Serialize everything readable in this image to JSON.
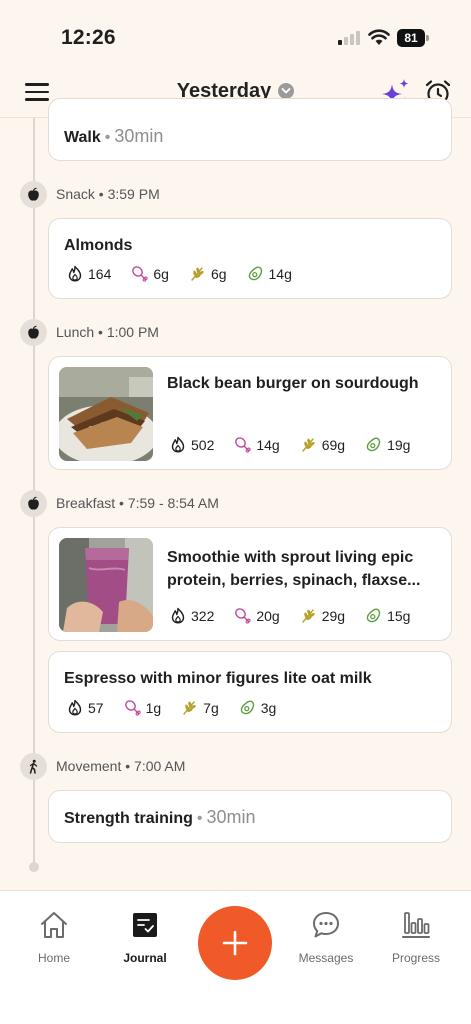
{
  "status_bar": {
    "time": "12:26",
    "battery": "81"
  },
  "header": {
    "title": "Yesterday"
  },
  "entries": {
    "walk": {
      "title": "Walk",
      "duration": "30min"
    },
    "snack": {
      "label": "Snack • 3:59 PM",
      "items": [
        {
          "title": "Almonds",
          "calories": "164",
          "protein": "6g",
          "carbs": "6g",
          "fat": "14g"
        }
      ]
    },
    "lunch": {
      "label": "Lunch • 1:00 PM",
      "items": [
        {
          "title": "Black bean burger on sourdough",
          "calories": "502",
          "protein": "14g",
          "carbs": "69g",
          "fat": "19g"
        }
      ]
    },
    "breakfast": {
      "label": "Breakfast • 7:59 - 8:54 AM",
      "items": [
        {
          "title_line1": "Smoothie with sprout living epic",
          "title_line2": "protein, berries, spinach, flaxse...",
          "calories": "322",
          "protein": "20g",
          "carbs": "29g",
          "fat": "15g"
        },
        {
          "title": "Espresso with minor figures lite oat milk",
          "calories": "57",
          "protein": "1g",
          "carbs": "7g",
          "fat": "3g"
        }
      ]
    },
    "movement": {
      "label": "Movement • 7:00 AM",
      "items": [
        {
          "title": "Strength training",
          "duration": "30min"
        }
      ]
    }
  },
  "nav": {
    "home": "Home",
    "journal": "Journal",
    "messages": "Messages",
    "progress": "Progress"
  },
  "icons": {
    "menu": "hamburger-icon",
    "title_dropdown": "chevron-down-icon",
    "ai": "sparkles-icon",
    "alarm": "alarm-clock-icon",
    "meal": "apple-icon",
    "movement": "walking-person-icon",
    "calories": "flame-icon",
    "protein": "drumstick-icon",
    "carbs": "wheat-icon",
    "fat": "avocado-icon",
    "add": "plus-icon"
  },
  "colors": {
    "background": "#fdf6ef",
    "accent": "#f05a28",
    "sparkle": "#6c3fd6",
    "protein": "#c04a9c",
    "carbs": "#b7a12a",
    "fat": "#5ea041"
  }
}
